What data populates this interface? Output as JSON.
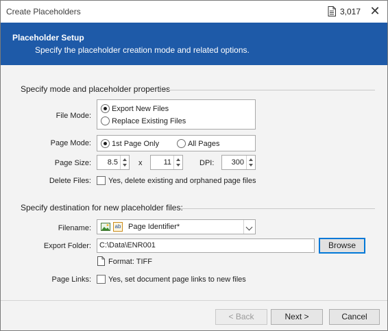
{
  "window": {
    "title": "Create Placeholders",
    "count": "3,017",
    "close_glyph": "✕"
  },
  "header": {
    "title": "Placeholder Setup",
    "subtitle": "Specify the placeholder creation mode and related options."
  },
  "mode_section": {
    "title": "Specify mode and placeholder properties",
    "file_mode": {
      "label": "File Mode:",
      "options": [
        "Export New Files",
        "Replace Existing Files"
      ],
      "selected": "Export New Files"
    },
    "page_mode": {
      "label": "Page Mode:",
      "options": [
        "1st Page Only",
        "All Pages"
      ],
      "selected": "1st Page Only"
    },
    "page_size": {
      "label": "Page Size:",
      "width": "8.5",
      "separator": "x",
      "height": "11",
      "dpi_label": "DPI:",
      "dpi": "300"
    },
    "delete_files": {
      "label": "Delete Files:",
      "checkbox_text": "Yes, delete existing and orphaned page files",
      "checked": false
    }
  },
  "destination_section": {
    "title": "Specify destination for new placeholder files:",
    "filename": {
      "label": "Filename:",
      "value": "Page Identifier*",
      "icon_text": "ab"
    },
    "export_folder": {
      "label": "Export Folder:",
      "value": "C:\\Data\\ENR001",
      "browse_label": "Browse"
    },
    "format_text": "Format: TIFF",
    "page_links": {
      "label": "Page Links:",
      "checkbox_text": "Yes, set document page links to new files",
      "checked": false
    }
  },
  "footer": {
    "back_label": "< Back",
    "next_label": "Next >",
    "cancel_label": "Cancel"
  },
  "colors": {
    "header_band": "#1e5aa8",
    "focus_border": "#0078d7"
  }
}
